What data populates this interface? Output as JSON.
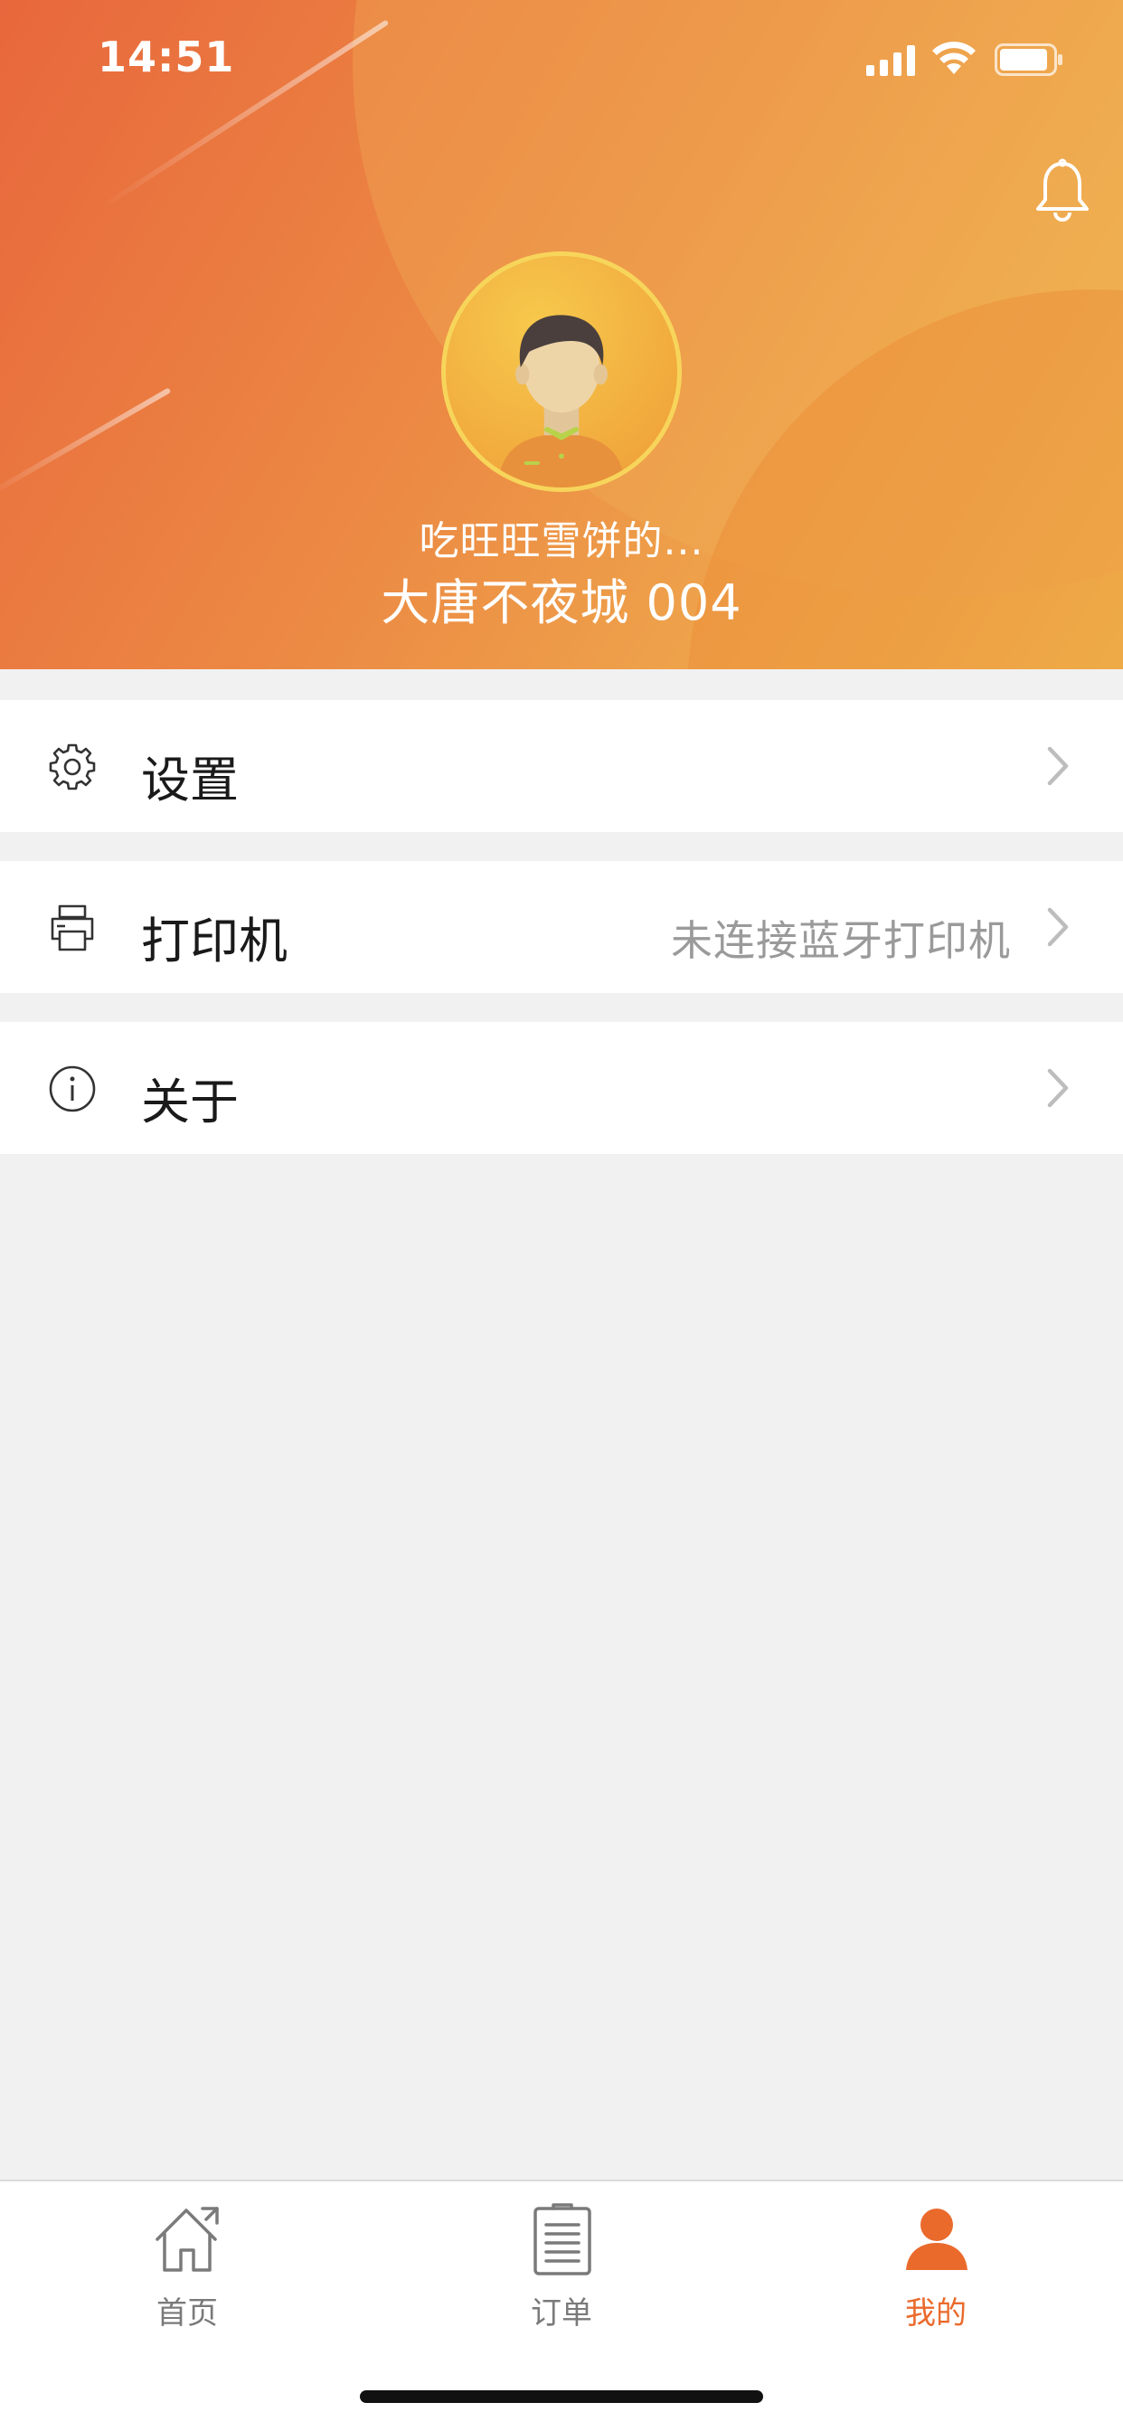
{
  "status_bar": {
    "time": "14:51"
  },
  "profile": {
    "store_name": "吃旺旺雪饼的...",
    "branch_name": "大唐不夜城 004"
  },
  "menu": [
    {
      "label": "设置",
      "value": "",
      "icon": "gear-icon"
    },
    {
      "label": "打印机",
      "value": "未连接蓝牙打印机",
      "icon": "printer-icon"
    },
    {
      "label": "关于",
      "value": "",
      "icon": "info-icon"
    }
  ],
  "tabs": [
    {
      "label": "首页",
      "icon": "home-icon",
      "active": false
    },
    {
      "label": "订单",
      "icon": "order-list-icon",
      "active": false
    },
    {
      "label": "我的",
      "icon": "user-icon",
      "active": true
    }
  ],
  "colors": {
    "accent": "#ea6a2c",
    "header_start": "#e8673c",
    "header_end": "#f1c555"
  }
}
